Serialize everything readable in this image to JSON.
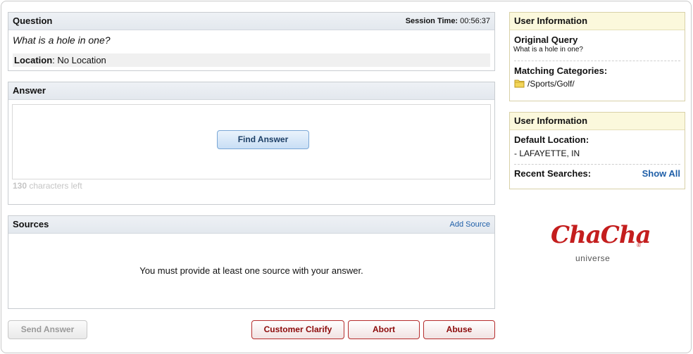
{
  "question": {
    "title": "Question",
    "session_label": "Session Time:",
    "session_time": "00:56:37",
    "text": "What is a hole in one?",
    "location_label": "Location",
    "location_value": ": No Location"
  },
  "answer": {
    "title": "Answer",
    "find_button": "Find Answer",
    "chars_count": "130",
    "chars_label": " characters left"
  },
  "sources": {
    "title": "Sources",
    "add_link": "Add Source",
    "message": "You must provide at least one source with your answer."
  },
  "buttons": {
    "send": "Send Answer",
    "clarify": "Customer Clarify",
    "abort": "Abort",
    "abuse": "Abuse"
  },
  "user_info_1": {
    "title": "User Information",
    "original_query_label": "Original Query",
    "original_query": "What is a hole in one?",
    "categories_label": "Matching Categories:",
    "category": "/Sports/Golf/"
  },
  "user_info_2": {
    "title": "User Information",
    "default_location_label": "Default Location:",
    "default_location": "- LAFAYETTE, IN",
    "recent_label": "Recent Searches:",
    "show_all": "Show All"
  },
  "logo": {
    "name": "ChaCha",
    "registered": "®",
    "sub": "universe"
  },
  "colors": {
    "link": "#1f5fa8",
    "danger": "#8c0b0b",
    "brand": "#c41e1e",
    "primary_button": "#c8def5"
  }
}
